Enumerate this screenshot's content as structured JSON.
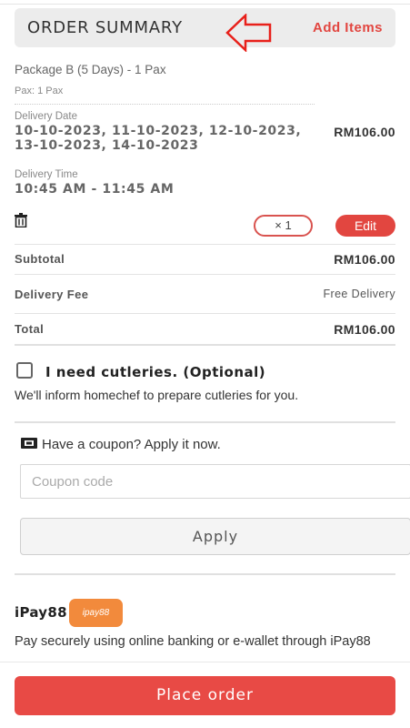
{
  "header": {
    "title": "ORDER SUMMARY",
    "add_items_label": "Add Items"
  },
  "item": {
    "name": "Package B (5 Days) - 1 Pax",
    "pax": "Pax: 1 Pax",
    "delivery_date_label": "Delivery Date",
    "delivery_dates": "10-10-2023, 11-10-2023, 12-10-2023, 13-10-2023, 14-10-2023",
    "delivery_time_label": "Delivery Time",
    "delivery_time": "10:45 AM - 11:45 AM",
    "price": "RM106.00",
    "quantity": "× 1",
    "edit_label": "Edit"
  },
  "totals": {
    "subtotal_label": "Subtotal",
    "subtotal_value": "RM106.00",
    "delivery_fee_label": "Delivery Fee",
    "delivery_fee_value": "Free Delivery",
    "total_label": "Total",
    "total_value": "RM106.00"
  },
  "cutlery": {
    "label": "I need cutleries. (Optional)",
    "checked": false,
    "note": "We'll inform homechef to prepare cutleries for you."
  },
  "coupon": {
    "title": "Have a coupon? Apply it now.",
    "placeholder": "Coupon code",
    "apply_label": "Apply"
  },
  "payment": {
    "name": "iPay88",
    "logo_text": "ipay88",
    "description": "Pay securely using online banking or e-wallet through iPay88"
  },
  "footer": {
    "place_order_label": "Place order"
  },
  "colors": {
    "accent": "#e24640",
    "place_order": "#e84a45",
    "ipay_logo": "#f28a3c"
  }
}
